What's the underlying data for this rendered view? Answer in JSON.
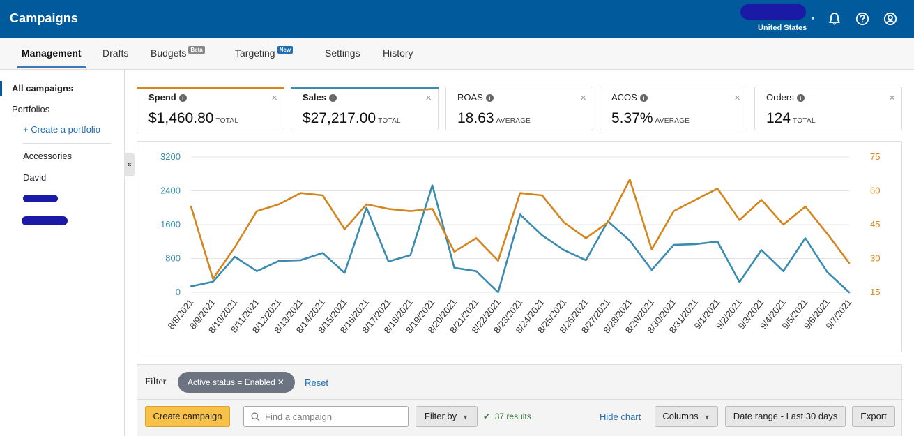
{
  "header": {
    "title": "Campaigns",
    "account_country": "United States"
  },
  "tabs": [
    {
      "label": "Management",
      "active": true
    },
    {
      "label": "Drafts"
    },
    {
      "label": "Budgets",
      "badge": "Beta"
    },
    {
      "label": "Targeting",
      "badge": "New"
    },
    {
      "label": "Settings"
    },
    {
      "label": "History"
    }
  ],
  "sidebar": {
    "all_campaigns": "All campaigns",
    "portfolios": "Portfolios",
    "create_portfolio": "+ Create a portfolio",
    "items": [
      "Accessories",
      "David"
    ]
  },
  "metrics": [
    {
      "label": "Spend",
      "value": "$1,460.80",
      "unit": "TOTAL",
      "color": "#d4851e",
      "selected": true
    },
    {
      "label": "Sales",
      "value": "$27,217.00",
      "unit": "TOTAL",
      "color": "#3a8bb0",
      "selected": true
    },
    {
      "label": "ROAS",
      "value": "18.63",
      "unit": "AVERAGE"
    },
    {
      "label": "ACOS",
      "value": "5.37%",
      "unit": "AVERAGE"
    },
    {
      "label": "Orders",
      "value": "124",
      "unit": "TOTAL"
    }
  ],
  "chart_data": {
    "type": "line",
    "x": [
      "8/8/2021",
      "8/9/2021",
      "8/10/2021",
      "8/11/2021",
      "8/12/2021",
      "8/13/2021",
      "8/14/2021",
      "8/15/2021",
      "8/16/2021",
      "8/17/2021",
      "8/18/2021",
      "8/19/2021",
      "8/20/2021",
      "8/21/2021",
      "8/22/2021",
      "8/23/2021",
      "8/24/2021",
      "8/25/2021",
      "8/26/2021",
      "8/27/2021",
      "8/28/2021",
      "8/29/2021",
      "8/30/2021",
      "8/31/2021",
      "9/1/2021",
      "9/2/2021",
      "9/3/2021",
      "9/4/2021",
      "9/5/2021",
      "9/6/2021",
      "9/7/2021"
    ],
    "y_left": {
      "ticks": [
        0,
        800,
        1600,
        2400,
        3200
      ],
      "ylim": [
        0,
        3200
      ],
      "color": "#3a8bb0"
    },
    "y_right": {
      "ticks": [
        15,
        30,
        45,
        60,
        75
      ],
      "ylim": [
        15,
        75
      ],
      "color": "#d4851e"
    },
    "series": [
      {
        "axis": "left",
        "color": "#3a8bb0",
        "values": [
          140,
          250,
          840,
          500,
          740,
          760,
          930,
          460,
          2000,
          730,
          880,
          2530,
          580,
          500,
          0,
          1840,
          1350,
          1000,
          760,
          1680,
          1220,
          530,
          1120,
          1140,
          1200,
          240,
          1000,
          500,
          1280,
          480,
          0
        ]
      },
      {
        "axis": "right",
        "color": "#d4851e",
        "values": [
          53,
          21,
          35,
          51,
          54,
          59,
          58,
          43,
          54,
          52,
          51,
          52,
          33,
          39,
          29,
          59,
          58,
          46,
          39,
          46,
          65,
          34,
          51,
          56,
          61,
          47,
          56,
          45,
          53,
          41,
          28
        ]
      }
    ],
    "grid": true
  },
  "filter": {
    "label": "Filter",
    "chip": "Active status = Enabled",
    "reset": "Reset"
  },
  "toolbar": {
    "create_campaign": "Create campaign",
    "search_placeholder": "Find a campaign",
    "filter_by": "Filter by",
    "results": "37 results",
    "hide_chart": "Hide chart",
    "columns": "Columns",
    "date_range": "Date range - Last 30 days",
    "export": "Export"
  }
}
